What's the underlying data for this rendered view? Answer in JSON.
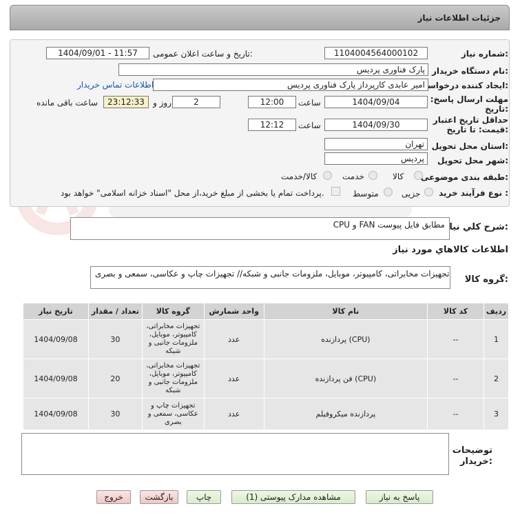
{
  "header": {
    "title": "جزئیات اطلاعات نیاز"
  },
  "form": {
    "need_number_label": "شماره نیاز:",
    "need_number": "1104004564000102",
    "announce_label": "تاریخ و ساعت اعلان عمومی:",
    "announce_value": "1404/09/01 - 11:57",
    "buyer_org_label": "نام دستگاه خریدار:",
    "buyer_org": "پارک فناوری پردیس",
    "creator_label": "ایجاد کننده درخواست:",
    "creator": "امیر عابدی کارپرداز پارک فناوری پردیس",
    "contact_link": "اطلاعات تماس خریدار",
    "deadline_label_1": "مهلت ارسال پاسخ: تا",
    "deadline_label_2": "تاریخ:",
    "deadline_date": "1404/09/04",
    "time_label": "ساعت",
    "deadline_time": "12:00",
    "days_value": "2",
    "days_label": "روز و",
    "remaining_time": "23:12:33",
    "remaining_label": "ساعت باقی مانده",
    "validity_label_1": "حداقل تاریخ اعتبار",
    "validity_label_2": "قیمت: تا تاریخ:",
    "validity_date": "1404/09/30",
    "validity_time_label": "ساعت",
    "validity_time": "12:12",
    "province_label": "استان محل تحویل:",
    "province": "تهران",
    "city_label": "شهر محل تحویل:",
    "city": "پردیس",
    "category_label": "طبقه بندی موضوعی:",
    "category_options": [
      "کالا",
      "خدمت",
      "کالا/خدمت"
    ],
    "process_label": "نوع فرآیند خرید :",
    "process_options": [
      "جزیی",
      "متوسط"
    ],
    "payment_note": "پرداخت تمام یا بخشی از مبلغ خرید،از محل \"اسناد خزانه اسلامی\" خواهد بود."
  },
  "summary": {
    "label": "شرح کلي نياز:",
    "value": "CPU و FAN مطابق فایل پیوست"
  },
  "goods_section": {
    "title": "اطلاعات کالاهاي مورد نياز"
  },
  "goods_group": {
    "label": "گروه کالا:",
    "value": "تجهیزات مخابراتی، کامپیوتر، موبایل، ملزومات جانبی و شبکه// تجهیزات چاپ و عکاسی، سمعی و بصری"
  },
  "table": {
    "headers": [
      "ردیف",
      "کد کالا",
      "نام کالا",
      "واحد شمارش",
      "گروه کالا",
      "تعداد / مقدار",
      "تاریخ نیاز"
    ],
    "rows": [
      {
        "row": "1",
        "code": "--",
        "name": "پردازنده (CPU)",
        "unit": "عدد",
        "group": "تجهیزات مخابراتی، کامپیوتر، موبایل، ملزومات جانبی و شبکه",
        "qty": "30",
        "date": "1404/09/08"
      },
      {
        "row": "2",
        "code": "--",
        "name": "فن پردازنده (CPU)",
        "unit": "عدد",
        "group": "تجهیزات مخابراتی، کامپیوتر، موبایل، ملزومات جانبی و شبکه",
        "qty": "20",
        "date": "1404/09/08"
      },
      {
        "row": "3",
        "code": "--",
        "name": "پردازنده میکروفیلم",
        "unit": "عدد",
        "group": "تجهیزات چاپ و عکاسی، سمعی و بصری",
        "qty": "30",
        "date": "1404/09/08"
      }
    ]
  },
  "buyer_notes": {
    "label_1": "توضیحات",
    "label_2": "خریدار:",
    "value": ""
  },
  "buttons": {
    "reply": "پاسخ به نیاز",
    "docs": "مشاهده مدارک پیوستی (1)",
    "print": "چاپ",
    "back": "بازگشت",
    "exit": "خروج"
  },
  "colors": {
    "title_bar": "#b9b9b9",
    "panel": "#f4f4f4",
    "link": "#1a56b8",
    "highlight": "#f6f1c8"
  }
}
